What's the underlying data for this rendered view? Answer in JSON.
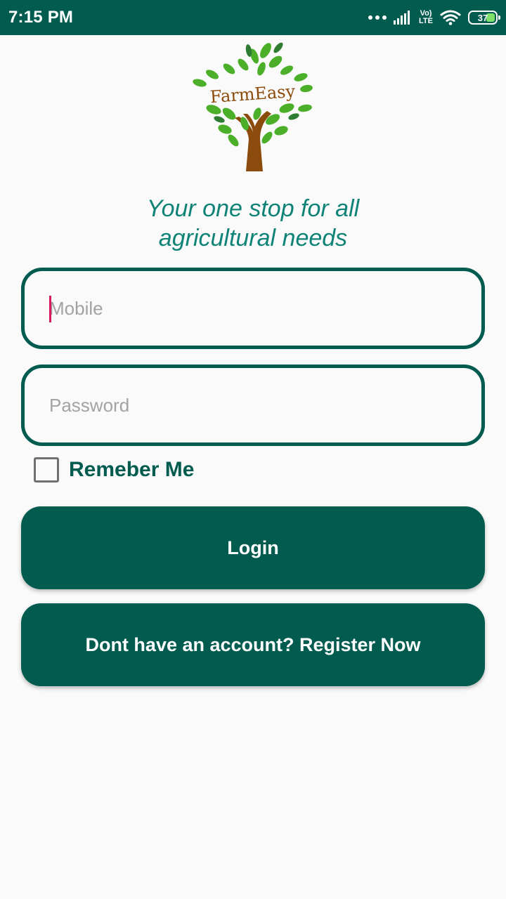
{
  "status_bar": {
    "time": "7:15 PM",
    "volte_top": "Vo)",
    "volte_bottom": "LTE",
    "battery": "37",
    "icons": [
      "signal-dots-icon",
      "signal-bars-icon",
      "volte-icon",
      "wifi-icon",
      "battery-icon"
    ]
  },
  "logo": {
    "text": "FarmEasy"
  },
  "tagline": {
    "line1": "Your one stop for all",
    "line2": "agricultural needs"
  },
  "form": {
    "mobile_placeholder": "Mobile",
    "password_placeholder": "Password",
    "remember_label": "Remeber Me"
  },
  "buttons": {
    "login": "Login",
    "register": "Dont have an account? Register Now"
  },
  "colors": {
    "primary": "#015b4f",
    "tagline": "#0f8375",
    "cursor": "#d81b60",
    "background": "#fafafa"
  }
}
